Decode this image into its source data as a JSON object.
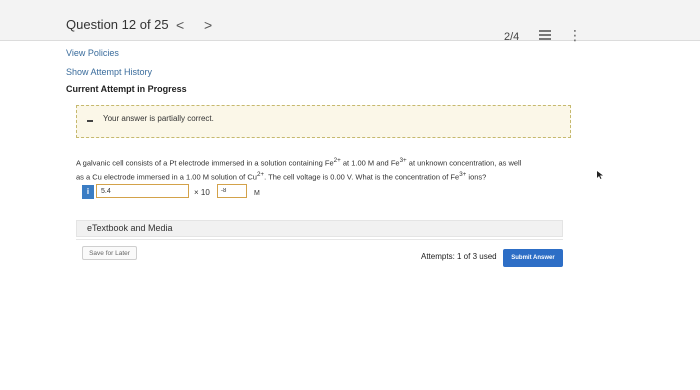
{
  "header": {
    "question_label": "Question 12 of 25",
    "prev_glyph": "<",
    "next_glyph": ">",
    "pager": "2/4",
    "list_icon": "list-icon",
    "more_icon": "more-vertical-icon"
  },
  "links": {
    "view_policies": "View Policies",
    "show_attempt_history": "Show Attempt History"
  },
  "current_attempt": "Current Attempt in Progress",
  "feedback": {
    "text": "Your answer is partially correct."
  },
  "question": {
    "line1_a": "A galvanic cell consists of a Pt electrode immersed in a solution containing Fe",
    "line1_sup1": "2+",
    "line1_b": " at 1.00 M and Fe",
    "line1_sup2": "3+",
    "line1_c": " at unknown concentration, as well",
    "line2_a": "as a Cu electrode immersed in a 1.00 M solution of Cu",
    "line2_sup1": "2+",
    "line2_b": ". The cell voltage is 0.00 V. What is the concentration of Fe",
    "line2_sup2": "3+",
    "line2_c": " ions?"
  },
  "answer": {
    "info_badge": "i",
    "value": "5.4",
    "times_ten": "× 10",
    "exponent": "-8",
    "unit": "M"
  },
  "etextbook": {
    "label": "eTextbook and Media"
  },
  "footer": {
    "save_label": "Save for Later",
    "attempts_text": "Attempts: 1 of 3 used",
    "submit_label": "Submit Answer"
  },
  "colors": {
    "submit": "#2d6ec6",
    "link": "#3a6c9c",
    "feedback_bg": "#fbf7e8",
    "input_border": "#d3a24a"
  }
}
